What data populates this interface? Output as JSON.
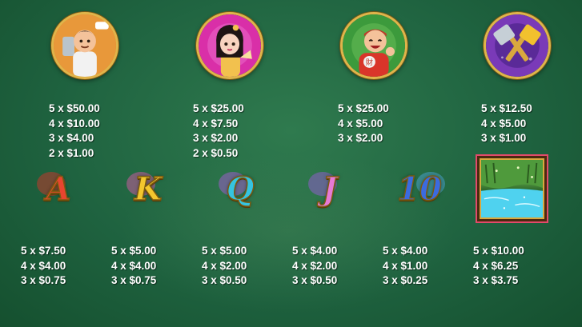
{
  "colors": {
    "background": "#1f6340",
    "gold_border": "#e0b44a",
    "text": "#ffffff",
    "wild_frame": "#e24a6a"
  },
  "top_symbols": [
    {
      "icon": "chef-with-cleaver-icon",
      "pays": [
        "5 x $50.00",
        "4 x $10.00",
        "3 x $4.00",
        "2 x $1.00"
      ]
    },
    {
      "icon": "lady-with-fan-icon",
      "pays": [
        "5 x $25.00",
        "4 x $7.50",
        "3 x $2.00",
        "2 x $0.50"
      ]
    },
    {
      "icon": "fortune-man-icon",
      "pays": [
        "5 x $25.00",
        "4 x $5.00",
        "3 x $2.00"
      ]
    },
    {
      "icon": "crossed-cleavers-icon",
      "pays": [
        "5 x $12.50",
        "4 x $5.00",
        "3 x $1.00"
      ]
    }
  ],
  "low_symbols": [
    {
      "label": "A",
      "color": "#e8452f",
      "swirl": "#c0392b",
      "pays": [
        "5 x $7.50",
        "4 x $4.00",
        "3 x $0.75"
      ]
    },
    {
      "label": "K",
      "color": "#f3c62e",
      "swirl": "#c95b9e",
      "pays": [
        "5 x $5.00",
        "4 x $4.00",
        "3 x $0.75"
      ]
    },
    {
      "label": "Q",
      "color": "#35c4e0",
      "swirl": "#9d5cc9",
      "pays": [
        "5 x $5.00",
        "4 x $2.00",
        "3 x $0.50"
      ]
    },
    {
      "label": "J",
      "color": "#e77ad6",
      "swirl": "#8e5cc9",
      "pays": [
        "5 x $4.00",
        "4 x $2.00",
        "3 x $0.50"
      ]
    },
    {
      "label": "10",
      "color": "#3b6be0",
      "swirl": "#4aa0c9",
      "pays": [
        "5 x $4.00",
        "4 x $1.00",
        "3 x $0.25"
      ]
    }
  ],
  "landscape_symbol": {
    "icon": "river-landscape-icon",
    "pays": [
      "5 x $10.00",
      "4 x $6.25",
      "3 x $3.75"
    ]
  }
}
